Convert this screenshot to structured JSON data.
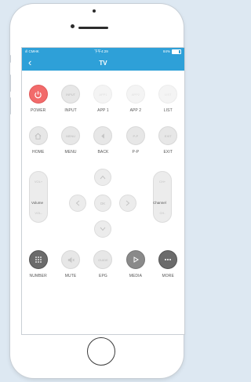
{
  "status_bar": {
    "carrier": "ıll CMHK",
    "time": "下午4:29",
    "battery": "84%"
  },
  "nav": {
    "title": "TV",
    "back_glyph": "‹"
  },
  "row1": [
    {
      "label": "POWER",
      "button_text": "",
      "style": "red",
      "icon": "power-icon"
    },
    {
      "label": "INPUT",
      "button_text": "INPUT",
      "style": "grey"
    },
    {
      "label": "APP 1",
      "button_text": "APP1",
      "style": "faint"
    },
    {
      "label": "APP 2",
      "button_text": "APP2",
      "style": "faint"
    },
    {
      "label": "LIST",
      "button_text": "LIST",
      "style": "faint"
    }
  ],
  "row2": [
    {
      "label": "HOME",
      "button_text": "",
      "style": "grey",
      "icon": "home-icon"
    },
    {
      "label": "MENU",
      "button_text": "MENU",
      "style": "grey"
    },
    {
      "label": "BACK",
      "button_text": "",
      "style": "grey",
      "icon": "back-icon"
    },
    {
      "label": "P-P",
      "button_text": "P-P",
      "style": "grey"
    },
    {
      "label": "EXIT",
      "button_text": "EXIT",
      "style": "grey"
    }
  ],
  "volume": {
    "up": "VOL+",
    "down": "VOL-",
    "label": "Volume"
  },
  "channel": {
    "up": "CH+",
    "down": "CH-",
    "label": "Channel"
  },
  "dpad": {
    "ok": "OK"
  },
  "row3": [
    {
      "label": "NUMBER",
      "button_text": "",
      "style": "dark",
      "icon": "keypad-icon"
    },
    {
      "label": "MUTE",
      "button_text": "",
      "style": "grey",
      "icon": "mute-icon"
    },
    {
      "label": "EPG",
      "button_text": "GUIDE",
      "style": "grey"
    },
    {
      "label": "MEDIA",
      "button_text": "",
      "style": "grey",
      "icon": "play-icon"
    },
    {
      "label": "MORE",
      "button_text": "",
      "style": "dark",
      "icon": "more-icon"
    }
  ],
  "colors": {
    "accent": "#2ea0d8",
    "power": "#f26b6b",
    "button": "#e7e7e7"
  }
}
